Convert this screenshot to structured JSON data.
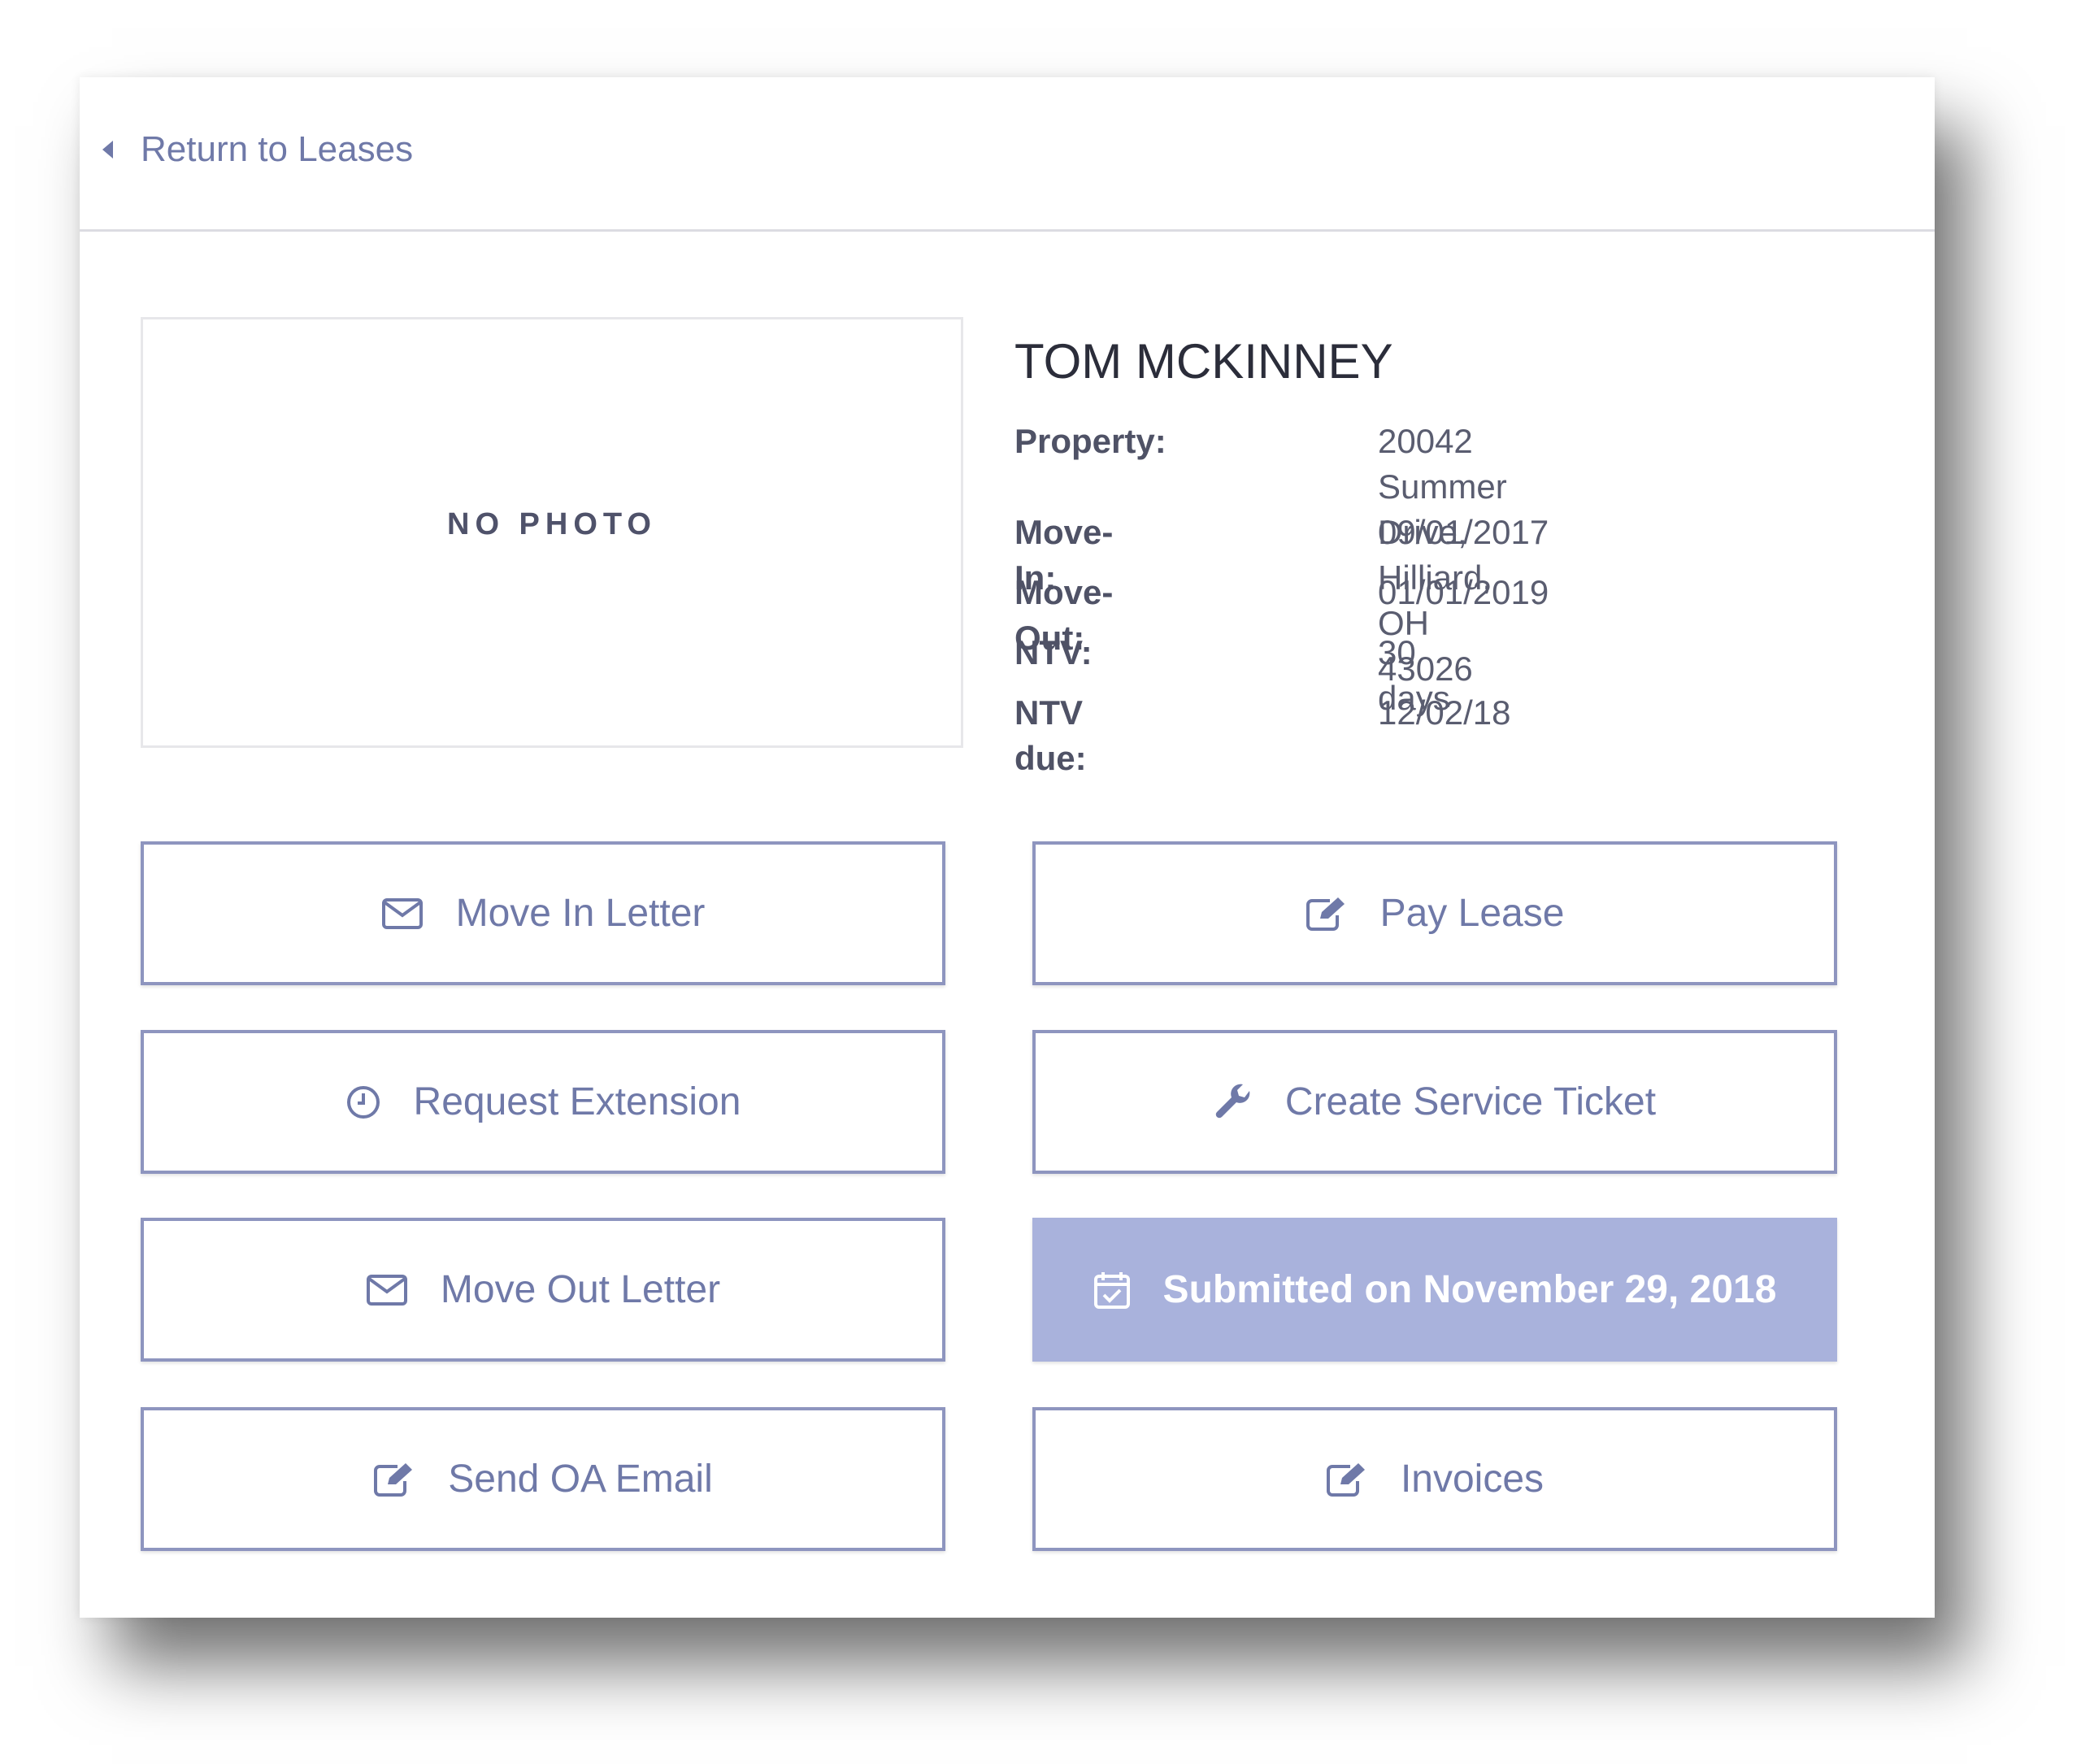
{
  "nav": {
    "back_label": "Return to Leases"
  },
  "photo": {
    "placeholder": "NO PHOTO"
  },
  "tenant": {
    "name": "TOM MCKINNEY",
    "fields": [
      {
        "label": "Property:",
        "value": "20042 Summer Drive,\nHilliard, OH 43026"
      },
      {
        "label": "Move-In:",
        "value": "09/01/2017"
      },
      {
        "label": "Move-Out:",
        "value": "01/01/2019"
      },
      {
        "label": "NTV:",
        "value": "30 days"
      },
      {
        "label": "NTV due:",
        "value": "12/02/18"
      }
    ]
  },
  "actions": {
    "move_in_letter": "Move In Letter",
    "pay_lease": "Pay Lease",
    "request_extension": "Request Extension",
    "create_service_ticket": "Create Service Ticket",
    "move_out_letter": "Move Out Letter",
    "submitted": "Submitted on November 29, 2018",
    "send_oa_email": "Send OA Email",
    "invoices": "Invoices"
  },
  "icons": {
    "envelope": "envelope-icon",
    "edit": "edit-icon",
    "clock": "clock-icon",
    "wrench": "wrench-icon",
    "calendar_check": "calendar-check-icon"
  },
  "colors": {
    "accent": "#6f79a8",
    "border": "#8e95bf",
    "filled": "#a9b2dc"
  }
}
